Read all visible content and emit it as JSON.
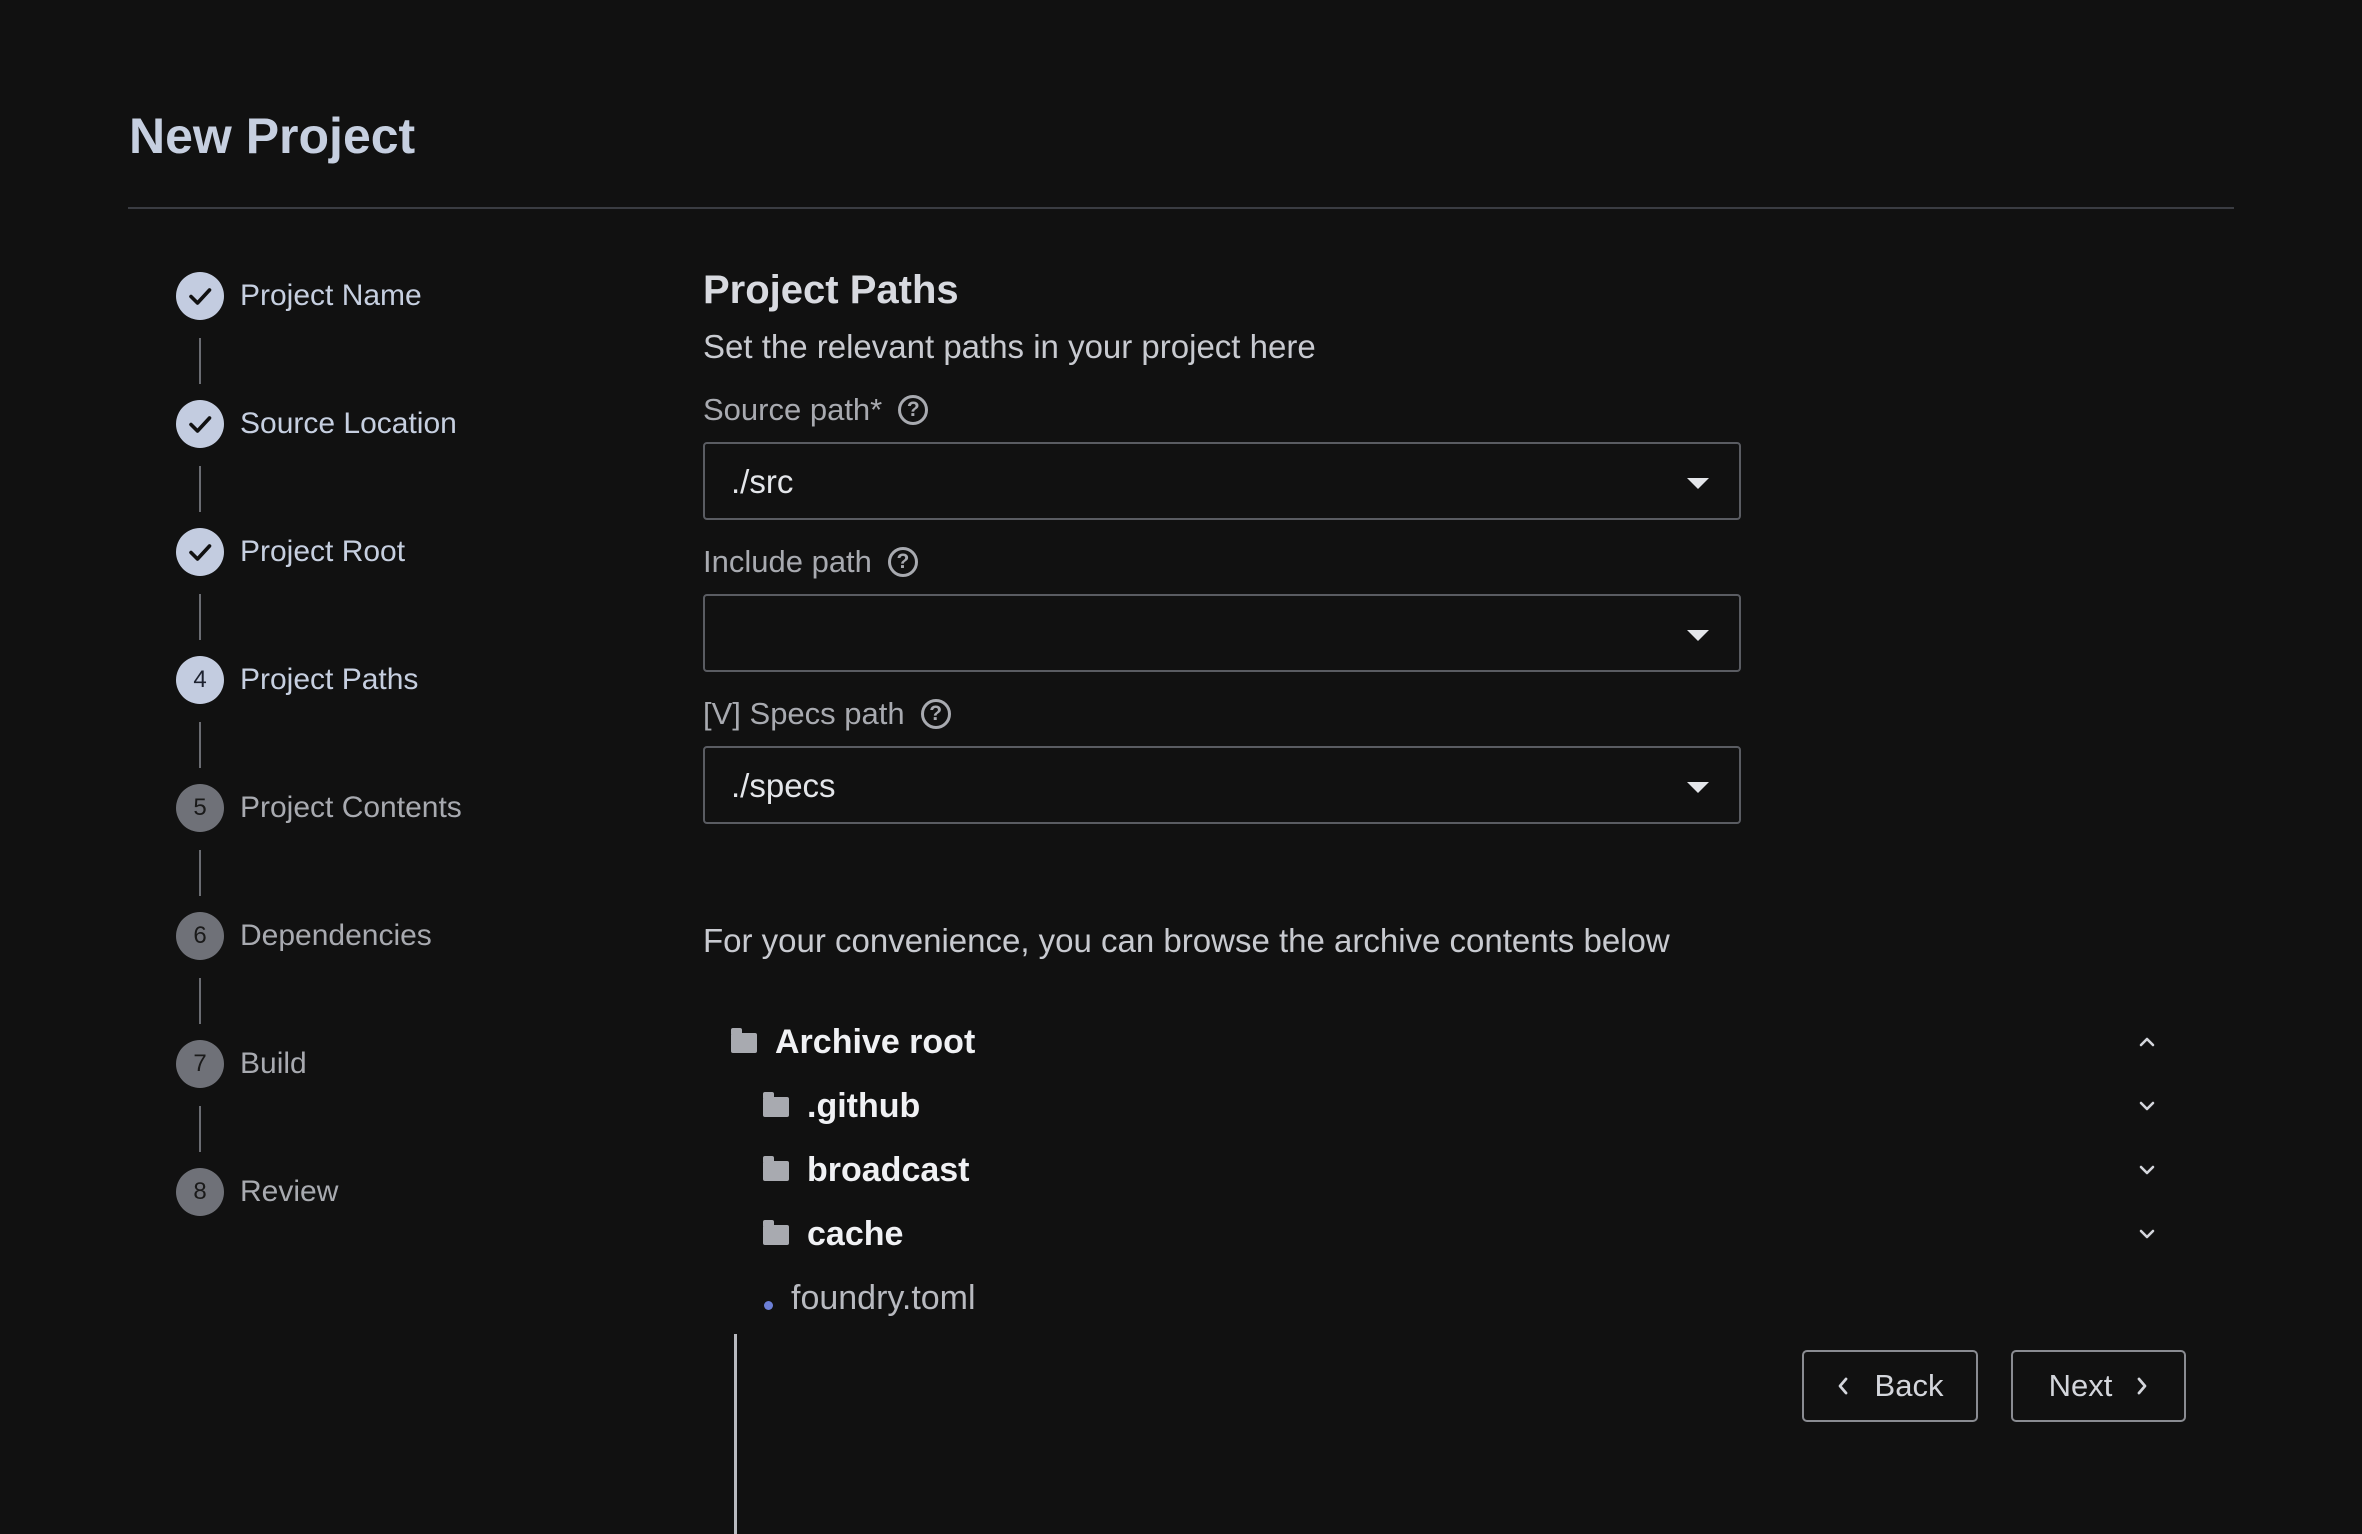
{
  "page": {
    "title": "New Project"
  },
  "stepper": {
    "steps": [
      {
        "number": "1",
        "label": "Project Name",
        "status": "done"
      },
      {
        "number": "2",
        "label": "Source Location",
        "status": "done"
      },
      {
        "number": "3",
        "label": "Project Root",
        "status": "done"
      },
      {
        "number": "4",
        "label": "Project Paths",
        "status": "current"
      },
      {
        "number": "5",
        "label": "Project Contents",
        "status": "pending"
      },
      {
        "number": "6",
        "label": "Dependencies",
        "status": "pending"
      },
      {
        "number": "7",
        "label": "Build",
        "status": "pending"
      },
      {
        "number": "8",
        "label": "Review",
        "status": "pending"
      }
    ]
  },
  "form": {
    "section_title": "Project Paths",
    "section_subtitle": "Set the relevant paths in your project here",
    "source_path": {
      "label": "Source path*",
      "value": "./src",
      "help_icon": "question-circle-icon"
    },
    "include_path": {
      "label": "Include path",
      "value": "",
      "help_icon": "question-circle-icon"
    },
    "specs_path": {
      "label": "[V] Specs path",
      "value": "./specs",
      "help_icon": "question-circle-icon"
    },
    "convenience_text": "For your convenience, you can browse the archive contents below"
  },
  "tree": {
    "root": {
      "label": "Archive root",
      "icon": "folder-icon",
      "expanded": true
    },
    "children": [
      {
        "label": ".github",
        "type": "folder",
        "icon": "folder-icon"
      },
      {
        "label": "broadcast",
        "type": "folder",
        "icon": "folder-icon"
      },
      {
        "label": "cache",
        "type": "folder",
        "icon": "folder-icon"
      },
      {
        "label": "foundry.toml",
        "type": "file"
      }
    ]
  },
  "actions": {
    "back_label": "Back",
    "next_label": "Next"
  },
  "colors": {
    "background": "#111111",
    "accent": "#c3cce0",
    "file_dot": "#6c7fd6"
  }
}
